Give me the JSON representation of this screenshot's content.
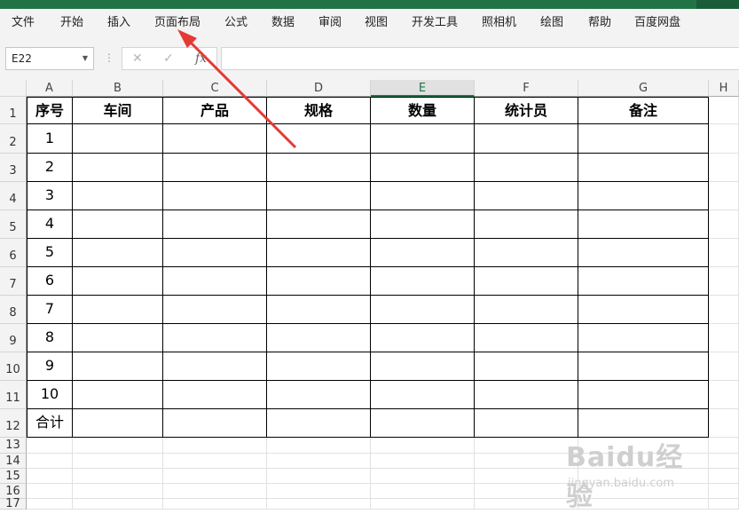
{
  "menu": {
    "items": [
      "文件",
      "开始",
      "插入",
      "页面布局",
      "公式",
      "数据",
      "审阅",
      "视图",
      "开发工具",
      "照相机",
      "绘图",
      "帮助",
      "百度网盘"
    ]
  },
  "formula_bar": {
    "name_box": "E22",
    "cancel_symbol": "✕",
    "enter_symbol": "✓",
    "fx_symbol": "fx",
    "formula_value": ""
  },
  "grid": {
    "columns": [
      "A",
      "B",
      "C",
      "D",
      "E",
      "F",
      "G",
      "H"
    ],
    "selected_column": "E",
    "rows": [
      "1",
      "2",
      "3",
      "4",
      "5",
      "6",
      "7",
      "8",
      "9",
      "10",
      "11",
      "12",
      "13",
      "14",
      "15",
      "16",
      "17"
    ]
  },
  "table": {
    "headers": [
      "序号",
      "车间",
      "产品",
      "规格",
      "数量",
      "统计员",
      "备注"
    ],
    "rows": [
      [
        "1",
        "",
        "",
        "",
        "",
        "",
        ""
      ],
      [
        "2",
        "",
        "",
        "",
        "",
        "",
        ""
      ],
      [
        "3",
        "",
        "",
        "",
        "",
        "",
        ""
      ],
      [
        "4",
        "",
        "",
        "",
        "",
        "",
        ""
      ],
      [
        "5",
        "",
        "",
        "",
        "",
        "",
        ""
      ],
      [
        "6",
        "",
        "",
        "",
        "",
        "",
        ""
      ],
      [
        "7",
        "",
        "",
        "",
        "",
        "",
        ""
      ],
      [
        "8",
        "",
        "",
        "",
        "",
        "",
        ""
      ],
      [
        "9",
        "",
        "",
        "",
        "",
        "",
        ""
      ],
      [
        "10",
        "",
        "",
        "",
        "",
        "",
        ""
      ],
      [
        "合计",
        "",
        "",
        "",
        "",
        "",
        ""
      ]
    ]
  },
  "watermark": {
    "logo_text": "Baidu经验",
    "url_text": "jingyan.baidu.com"
  },
  "annotation": {
    "arrow_color": "#e53935"
  }
}
